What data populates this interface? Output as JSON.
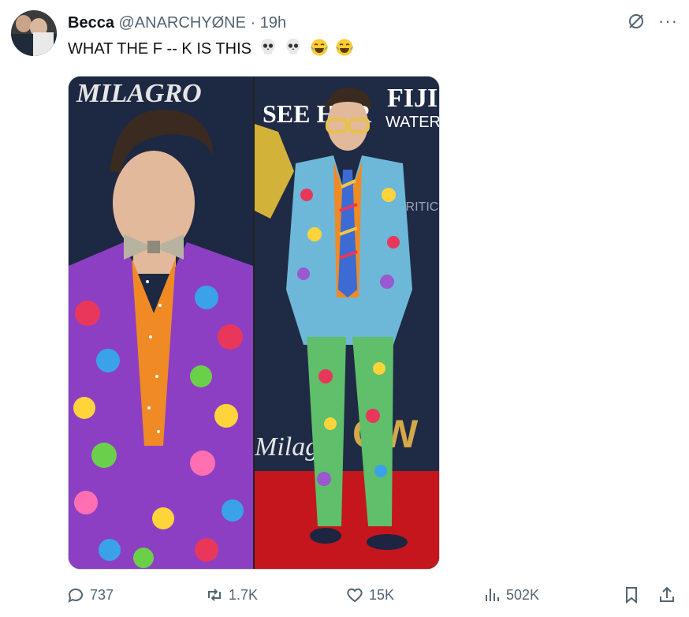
{
  "tweet": {
    "author_name": "Becca",
    "author_handle": "@ANARCHYØNE",
    "separator": "·",
    "time": "19h",
    "text": "WHAT THE F ‑‑ K IS THIS",
    "emojis": [
      "skull-emoji",
      "skull-emoji",
      "laughing-tears-emoji",
      "laughing-tears-emoji"
    ]
  },
  "media": {
    "left_sign_text": "MILAGRO",
    "right_sign_top": "SEE HER",
    "right_sign_brand": "FIJI",
    "right_sign_brand_sub": "WATER",
    "right_sign_event": "CRITICS CHOICE",
    "right_sign_bottom": "Milagro",
    "right_sign_cw": "CW"
  },
  "actions": {
    "replies": "737",
    "reposts": "1.7K",
    "likes": "15K",
    "views": "502K"
  },
  "colors": {
    "text_primary": "#0f1419",
    "text_secondary": "#536471",
    "border": "#cfd9de",
    "carpet": "#c4161c",
    "backdrop": "#1f2a44"
  }
}
